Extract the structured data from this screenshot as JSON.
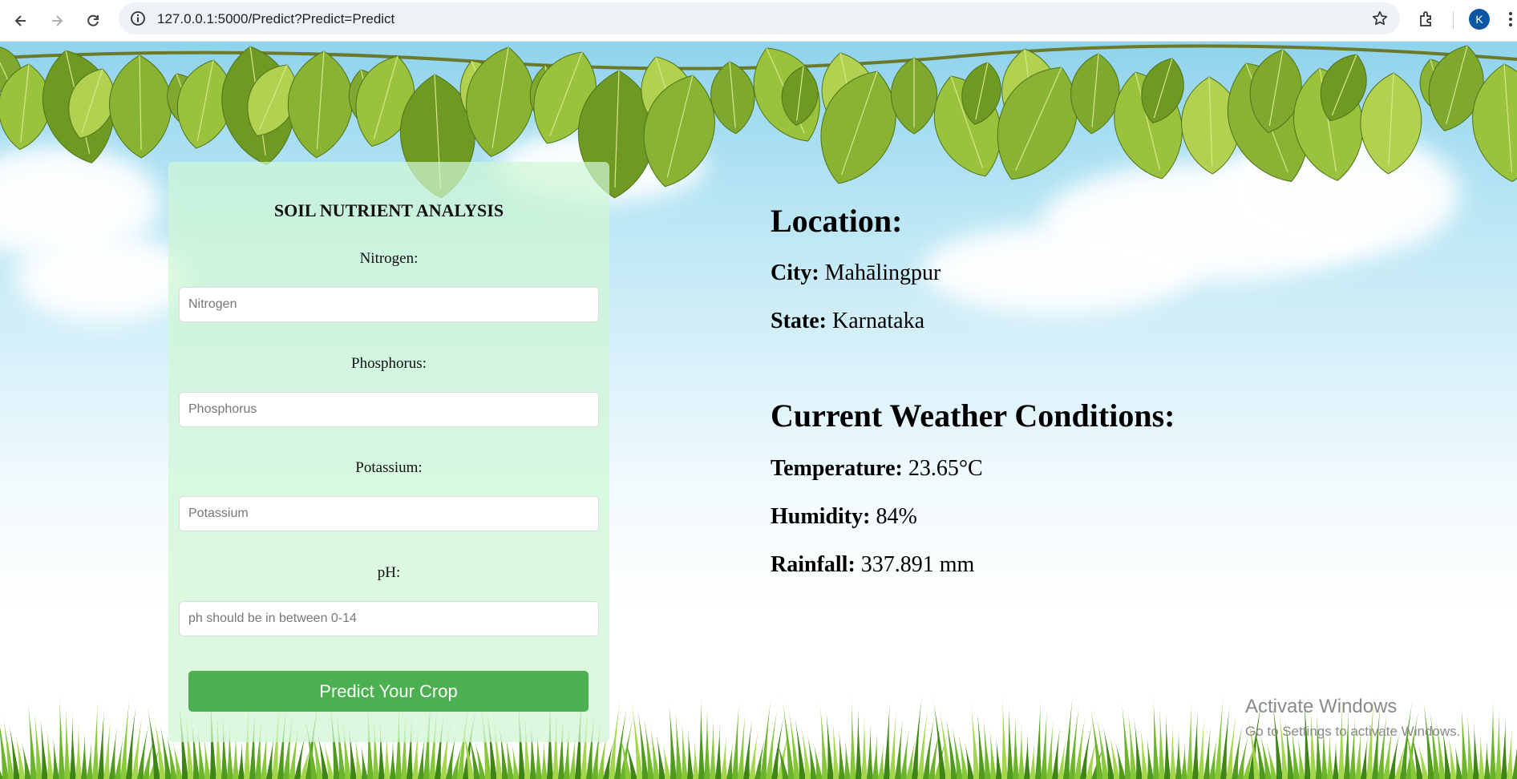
{
  "browser": {
    "url": "127.0.0.1:5000/Predict?Predict=Predict",
    "profile_initial": "K",
    "icons": [
      "back-arrow-icon",
      "forward-arrow-icon",
      "reload-icon",
      "info-icon",
      "star-icon",
      "extensions-icon",
      "more-vert-icon"
    ]
  },
  "form": {
    "title": "SOIL NUTRIENT ANALYSIS",
    "fields": [
      {
        "label": "Nitrogen:",
        "placeholder": "Nitrogen",
        "value": ""
      },
      {
        "label": "Phosphorus:",
        "placeholder": "Phosphorus",
        "value": ""
      },
      {
        "label": "Potassium:",
        "placeholder": "Potassium",
        "value": ""
      },
      {
        "label": "pH:",
        "placeholder": "ph should be in between 0-14",
        "value": ""
      }
    ],
    "submit_label": "Predict Your Crop",
    "button_color": "#4caf50"
  },
  "location": {
    "heading": "Location:",
    "city_label": "City:",
    "city": "Mahālingpur",
    "state_label": "State:",
    "state": "Karnataka"
  },
  "weather": {
    "heading": "Current Weather Conditions:",
    "temperature_label": "Temperature:",
    "temperature": "23.65°C",
    "humidity_label": "Humidity:",
    "humidity": "84%",
    "rainfall_label": "Rainfall:",
    "rainfall": "337.891 mm"
  },
  "watermark": {
    "title": "Activate Windows",
    "subtitle": "Go to Settings to activate Windows."
  }
}
